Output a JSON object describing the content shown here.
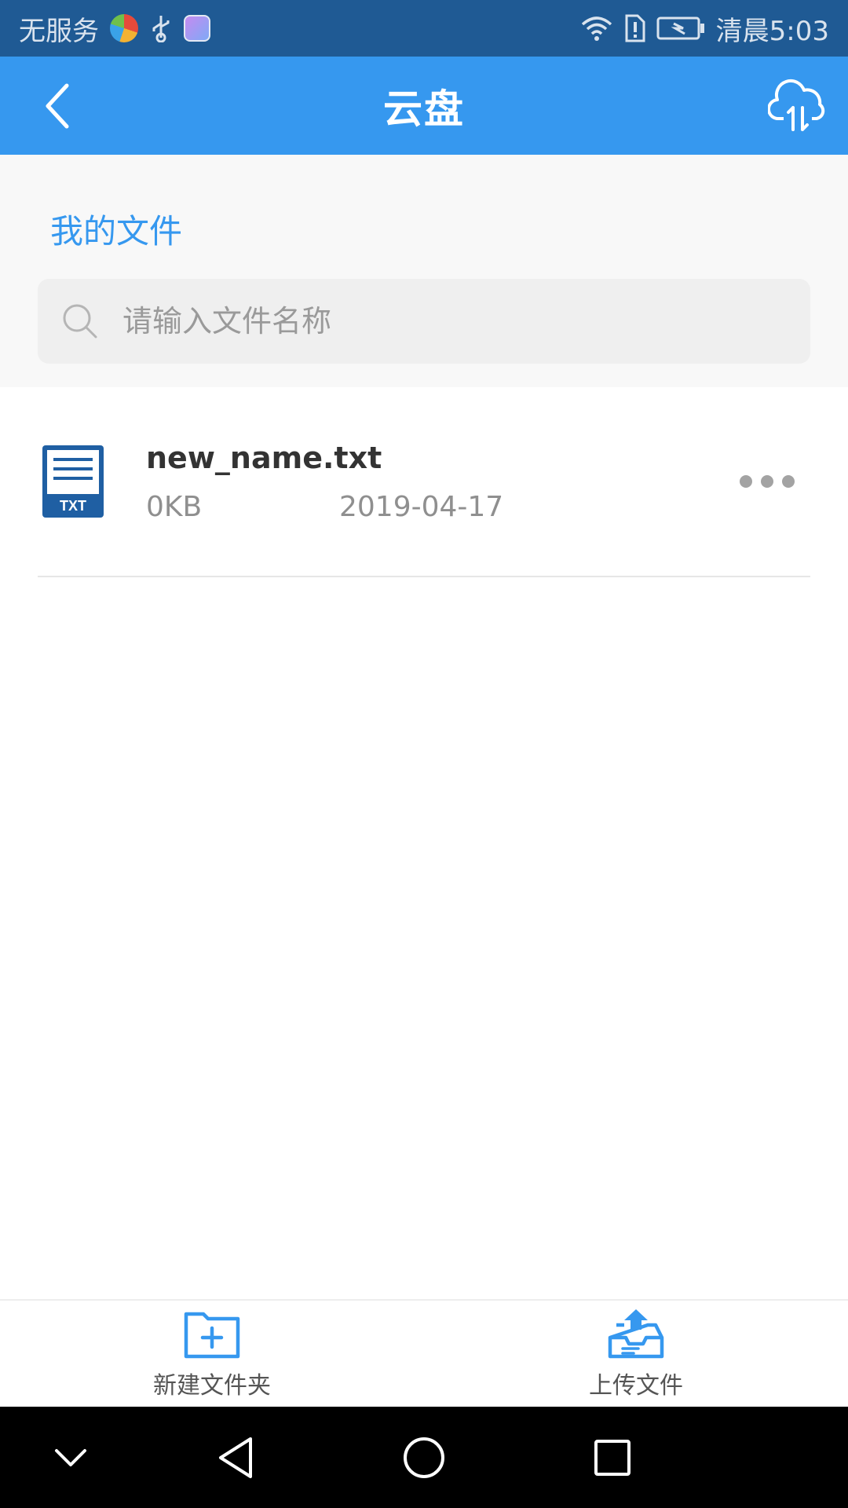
{
  "status_bar": {
    "carrier": "无服务",
    "time": "清晨5:03"
  },
  "app_bar": {
    "title": "云盘",
    "icons": {
      "back": "back-icon",
      "cloud_transfer": "cloud-transfer-icon"
    }
  },
  "header": {
    "section_title": "我的文件",
    "search_placeholder": "请输入文件名称"
  },
  "files": [
    {
      "name": "new_name.txt",
      "size": "0KB",
      "date": "2019-04-17",
      "type_label": "TXT"
    }
  ],
  "bottom_bar": {
    "new_folder_label": "新建文件夹",
    "upload_label": "上传文件"
  },
  "colors": {
    "accent": "#3698ef",
    "status_bar": "#1f5a94",
    "file_icon": "#1f5fa3"
  }
}
